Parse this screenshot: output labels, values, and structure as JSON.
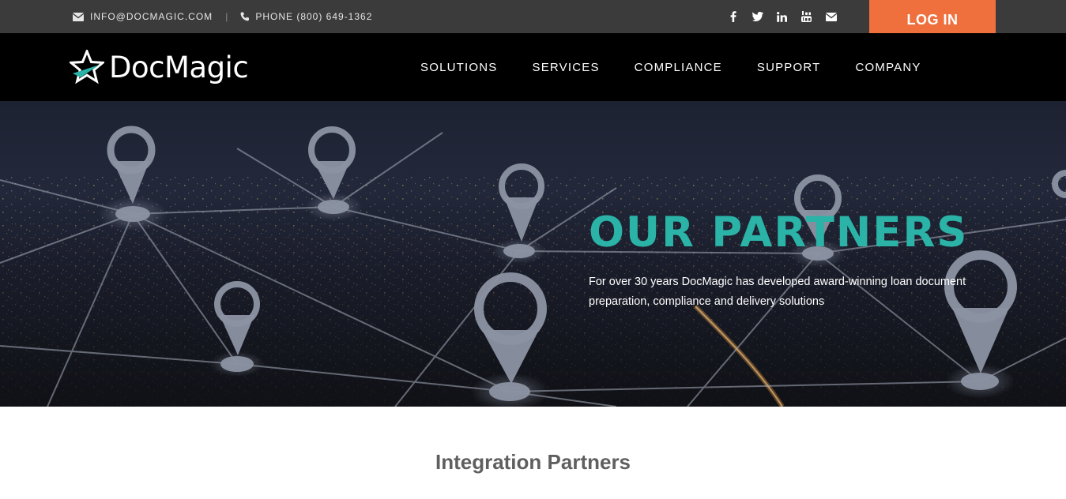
{
  "topbar": {
    "email": "INFO@DOCMAGIC.COM",
    "separator": "|",
    "phone": "PHONE (800) 649-1362",
    "social": [
      "facebook-icon",
      "twitter-icon",
      "linkedin-icon",
      "youtube-icon",
      "email-icon"
    ],
    "login_label": "LOG IN"
  },
  "header": {
    "brand": "DocMagic",
    "nav": [
      "SOLUTIONS",
      "SERVICES",
      "COMPLIANCE",
      "SUPPORT",
      "COMPANY"
    ]
  },
  "hero": {
    "title": "OUR PARTNERS",
    "description": "For over 30 years DocMagic has developed award-winning loan document preparation, compliance and delivery solutions"
  },
  "section": {
    "title": "Integration Partners"
  },
  "colors": {
    "accent_orange": "#f0703d",
    "accent_teal": "#2ab3a6",
    "topbar_bg": "#3b3b3b",
    "nav_bg": "#000000"
  }
}
